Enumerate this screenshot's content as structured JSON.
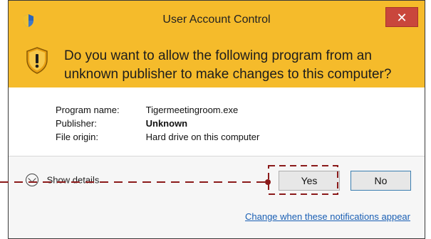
{
  "window": {
    "title": "User Account Control",
    "close_glyph": "✕"
  },
  "banner": {
    "question": "Do you want to allow the following program from an unknown publisher to make changes to this computer?"
  },
  "details": {
    "program_name_label": "Program name:",
    "program_name_value": "Tigermeetingroom.exe",
    "publisher_label": "Publisher:",
    "publisher_value": "Unknown",
    "file_origin_label": "File origin:",
    "file_origin_value": "Hard drive on this computer"
  },
  "actions": {
    "show_details_label": "Show details",
    "yes_label": "Yes",
    "no_label": "No",
    "notifications_link": "Change when these notifications appear"
  },
  "colors": {
    "banner": "#f5bb2b",
    "close_button": "#c9463c",
    "link": "#1a5fb4",
    "annotation": "#8b1a1a"
  },
  "icons": {
    "title": "uac-shield-icon",
    "banner": "warning-shield-icon",
    "details": "chevron-down-icon",
    "close": "close-icon"
  }
}
